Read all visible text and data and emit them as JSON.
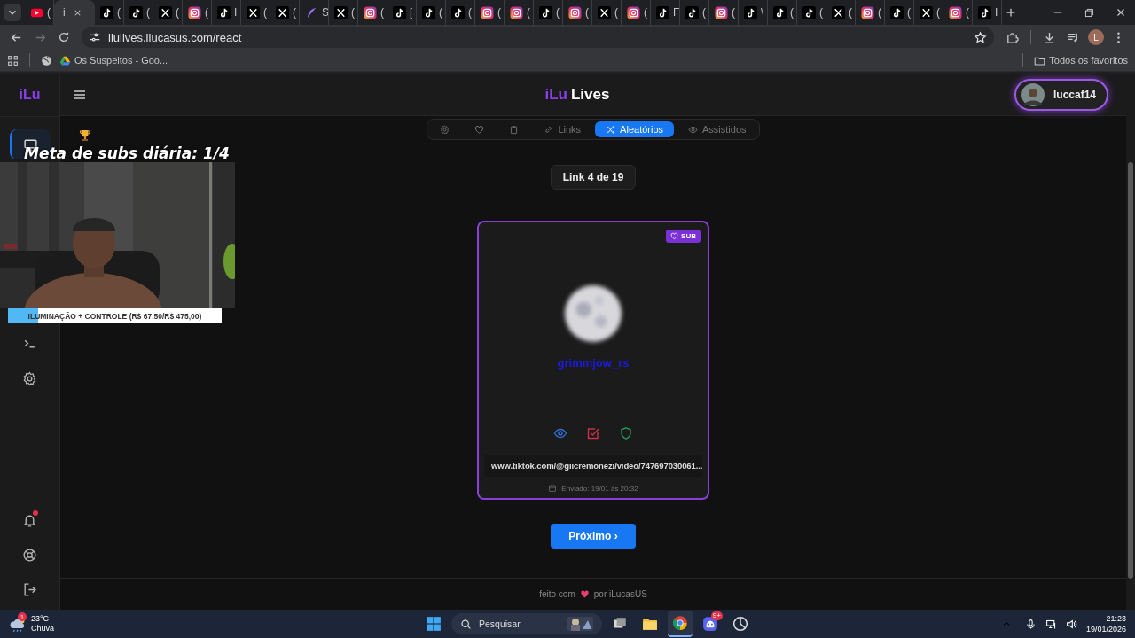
{
  "browser": {
    "tabs": [
      {
        "kind": "youtube",
        "title": "(",
        "selected": false
      },
      {
        "kind": "none",
        "title": "i",
        "selected": true
      },
      {
        "kind": "tiktok",
        "title": "(",
        "selected": false
      },
      {
        "kind": "tiktok",
        "title": "(",
        "selected": false
      },
      {
        "kind": "x",
        "title": "(",
        "selected": false
      },
      {
        "kind": "instagram",
        "title": "(",
        "selected": false
      },
      {
        "kind": "tiktok",
        "title": "I",
        "selected": false
      },
      {
        "kind": "x",
        "title": "(",
        "selected": false
      },
      {
        "kind": "x",
        "title": "(",
        "selected": false
      },
      {
        "kind": "feather",
        "title": "S",
        "selected": false
      },
      {
        "kind": "x",
        "title": "(",
        "selected": false
      },
      {
        "kind": "instagram",
        "title": "(",
        "selected": false
      },
      {
        "kind": "tiktok",
        "title": "[",
        "selected": false
      },
      {
        "kind": "tiktok",
        "title": "(",
        "selected": false
      },
      {
        "kind": "tiktok",
        "title": "(",
        "selected": false
      },
      {
        "kind": "instagram",
        "title": "(",
        "selected": false
      },
      {
        "kind": "instagram",
        "title": "(",
        "selected": false
      },
      {
        "kind": "tiktok",
        "title": "(",
        "selected": false
      },
      {
        "kind": "instagram",
        "title": "(",
        "selected": false
      },
      {
        "kind": "x",
        "title": "(",
        "selected": false
      },
      {
        "kind": "instagram",
        "title": "(",
        "selected": false
      },
      {
        "kind": "tiktok",
        "title": "F",
        "selected": false
      },
      {
        "kind": "tiktok",
        "title": "(",
        "selected": false
      },
      {
        "kind": "instagram",
        "title": "(",
        "selected": false
      },
      {
        "kind": "tiktok",
        "title": "\\",
        "selected": false
      },
      {
        "kind": "tiktok",
        "title": "(",
        "selected": false
      },
      {
        "kind": "tiktok",
        "title": "(",
        "selected": false
      },
      {
        "kind": "x",
        "title": "(",
        "selected": false
      },
      {
        "kind": "instagram",
        "title": "(",
        "selected": false
      },
      {
        "kind": "tiktok",
        "title": "(",
        "selected": false
      },
      {
        "kind": "x",
        "title": "(",
        "selected": false
      },
      {
        "kind": "instagram",
        "title": "(",
        "selected": false
      },
      {
        "kind": "tiktok",
        "title": "I",
        "selected": false
      }
    ],
    "address": "ilulives.ilucasus.com/react",
    "bookmarks": [
      {
        "label": "Os Suspeitos - Goo..."
      }
    ],
    "all_bookmarks": "Todos os favoritos",
    "profile_initial": "L"
  },
  "sidebar": {
    "logo": "iLu",
    "items": [
      {
        "kind": "monitor",
        "selected": true
      },
      {
        "kind": "terminal",
        "selected": false
      },
      {
        "kind": "settings",
        "selected": false
      }
    ],
    "bottom_items": [
      {
        "kind": "bell",
        "badge": true
      },
      {
        "kind": "help",
        "badge": false
      },
      {
        "kind": "logout",
        "badge": false
      }
    ]
  },
  "header": {
    "logo_accent": "iLu",
    "logo_rest": "Lives",
    "user": "luccaf14"
  },
  "tabs": [
    {
      "kind": "settings",
      "selected": false
    },
    {
      "kind": "heart",
      "selected": false
    },
    {
      "kind": "clipboard",
      "selected": false
    },
    {
      "kind": "link",
      "label": "Links",
      "selected": false
    },
    {
      "kind": "shuffle",
      "label": "Aleatórios",
      "selected": true
    },
    {
      "kind": "eye",
      "label": "Assistidos",
      "selected": false
    }
  ],
  "counter": "Link 4 de 19",
  "card": {
    "badge": "SUB",
    "username": "grimmjow_rs",
    "actions": [
      {
        "kind": "eye",
        "color": "#2f6fd6"
      },
      {
        "kind": "check",
        "color": "#c8324a"
      },
      {
        "kind": "shield",
        "color": "#1f9a5a"
      }
    ],
    "url": "www.tiktok.com/@giicremonezi/video/747697030061...",
    "sent": "Enviado: 19/01 às 20:32"
  },
  "next_button": "Próximo ›",
  "footer": {
    "before": "feito com",
    "after": "por iLucasUS"
  },
  "overlay": {
    "goal": "Meta de subs diária: 1/4",
    "progress": {
      "label": "ILUMINAÇÃO + CONTROLE (R$ 67,50/R$ 475,00)",
      "level": 0.14
    }
  },
  "taskbar": {
    "weather": {
      "temp": "23°C",
      "condition": "Chuva",
      "badge": "1"
    },
    "search_placeholder": "Pesquisar",
    "apps": [
      {
        "kind": "taskview",
        "selected": false
      },
      {
        "kind": "folder",
        "selected": false
      },
      {
        "kind": "chrome",
        "selected": true
      },
      {
        "kind": "discord",
        "selected": false,
        "badge": "9+"
      },
      {
        "kind": "app",
        "selected": false
      }
    ],
    "time": "21:23",
    "date": "19/01/2026"
  }
}
